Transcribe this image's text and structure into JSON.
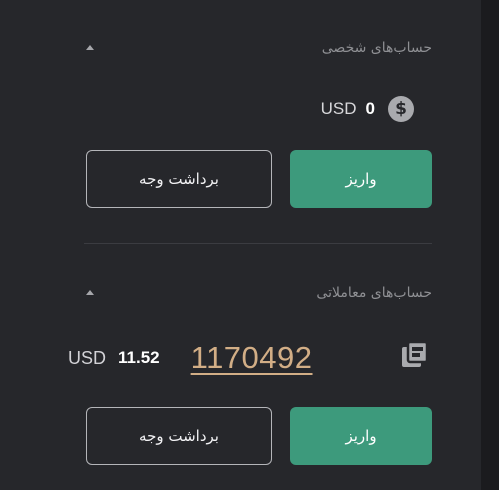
{
  "personal_accounts": {
    "title": "حساب‌های شخصی",
    "currency": "USD",
    "balance": "0",
    "icon": "dollar-coin-icon",
    "withdraw_label": "برداشت وجه",
    "deposit_label": "واریز"
  },
  "trading_accounts": {
    "title": "حساب‌های معاملاتی",
    "currency": "USD",
    "balance": "11.52",
    "account_number": "1170492",
    "icon": "copy-icon",
    "withdraw_label": "برداشت وجه",
    "deposit_label": "واریز"
  },
  "colors": {
    "panel_bg": "#26272b",
    "accent_green": "#3d9a7c",
    "account_number": "#d2ae86"
  }
}
